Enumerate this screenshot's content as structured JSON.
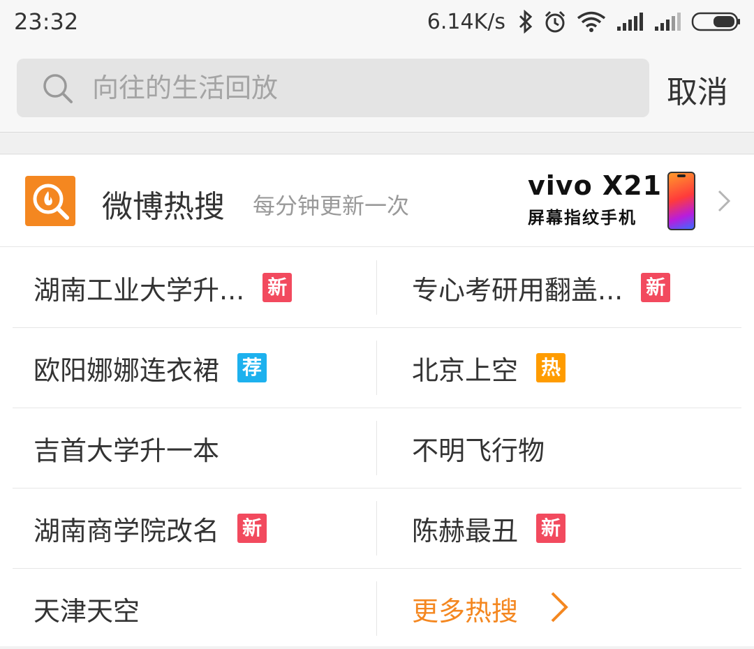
{
  "status_bar": {
    "time": "23:32",
    "net_speed": "6.14K/s",
    "icons": [
      "bluetooth-icon",
      "alarm-icon",
      "wifi-icon",
      "signal-icon",
      "signal-icon",
      "battery-icon"
    ]
  },
  "search": {
    "placeholder": "向往的生活回放",
    "cancel_label": "取消"
  },
  "hot_search": {
    "title": "微博热搜",
    "subtitle": "每分钟更新一次",
    "logo_icon": "weibo-hot-search-icon",
    "ad": {
      "brand": "vivo X21",
      "slogan": "屏幕指纹手机"
    },
    "rows": [
      {
        "left": {
          "text": "湖南工业大学升...",
          "badge": "新",
          "badge_type": "new"
        },
        "right": {
          "text": "专心考研用翻盖...",
          "badge": "新",
          "badge_type": "new"
        }
      },
      {
        "left": {
          "text": "欧阳娜娜连衣裙",
          "badge": "荐",
          "badge_type": "rec"
        },
        "right": {
          "text": "北京上空",
          "badge": "热",
          "badge_type": "hot"
        }
      },
      {
        "left": {
          "text": "吉首大学升一本",
          "badge": "",
          "badge_type": ""
        },
        "right": {
          "text": "不明飞行物",
          "badge": "",
          "badge_type": ""
        }
      },
      {
        "left": {
          "text": "湖南商学院改名",
          "badge": "新",
          "badge_type": "new"
        },
        "right": {
          "text": "陈赫最丑",
          "badge": "新",
          "badge_type": "new"
        }
      },
      {
        "left": {
          "text": "天津天空",
          "badge": "",
          "badge_type": ""
        }
      }
    ],
    "more_label": "更多热搜"
  },
  "colors": {
    "accent_orange": "#f48720",
    "badge_new": "#f24a5e",
    "badge_rec": "#1db1ee",
    "badge_hot": "#ff9c00"
  }
}
